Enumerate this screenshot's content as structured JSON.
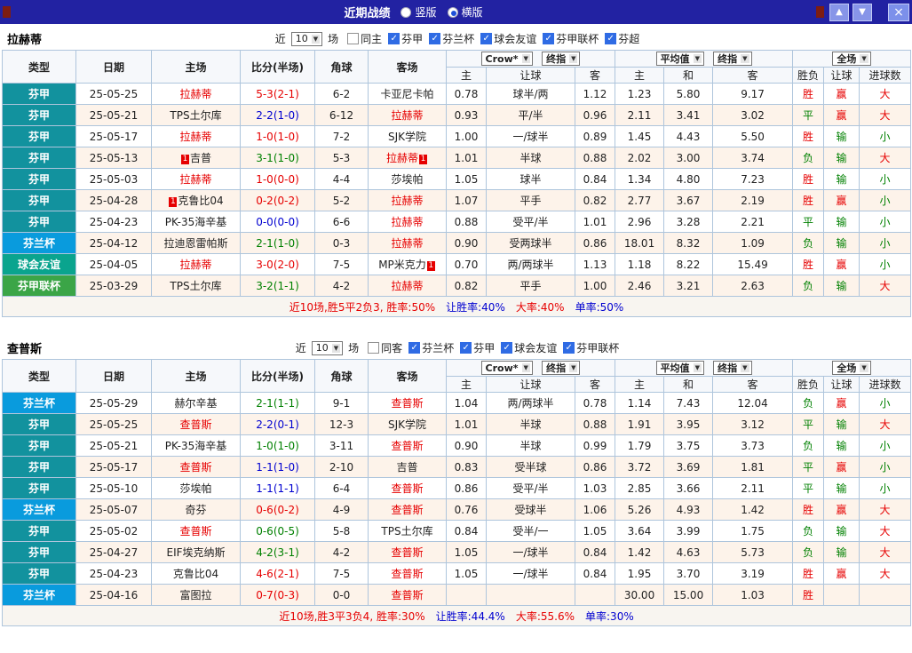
{
  "titlebar": {
    "title": "近期战绩",
    "radios": [
      {
        "label": "竖版",
        "checked": false
      },
      {
        "label": "横版",
        "checked": true
      }
    ]
  },
  "icons": {
    "up": "▲",
    "down": "▼",
    "close": "×",
    "dropdown": "▼",
    "check": "✓"
  },
  "colors": {
    "titlebar_bg": "#2222a2",
    "win_text": "#e60000",
    "loss_text": "#008000",
    "draw_text": "#0000d0",
    "checkbox_checked": "#2f6be4",
    "row_alt": "#fdf3ea"
  },
  "league_colors": {
    "芬甲": "#12929e",
    "芬兰杯": "#099bdd",
    "球会友谊": "#0aa48e",
    "芬甲联杯": "#3ba547"
  },
  "header": {
    "type": "类型",
    "date": "日期",
    "home": "主场",
    "score": "比分(半场)",
    "corners": "角球",
    "away": "客场",
    "odds_company": "Crow*",
    "stage": "终指",
    "average": "平均值",
    "stage2": "终指",
    "scope": "全场",
    "home_odds": "主",
    "handicap": "让球",
    "away_odds": "客",
    "avg_home": "主",
    "avg_draw": "和",
    "avg_away": "客",
    "win_loss": "胜负",
    "handicap_result": "让球",
    "goals": "进球数"
  },
  "sections": [
    {
      "team": "拉赫蒂",
      "filters": {
        "pre": "近",
        "count": "10",
        "post": "场",
        "items": [
          {
            "label": "同主",
            "checked": false
          },
          {
            "label": "芬甲",
            "checked": true
          },
          {
            "label": "芬兰杯",
            "checked": true
          },
          {
            "label": "球会友谊",
            "checked": true
          },
          {
            "label": "芬甲联杯",
            "checked": true
          },
          {
            "label": "芬超",
            "checked": true
          }
        ]
      },
      "rows": [
        {
          "type": "芬甲",
          "date": "25-05-25",
          "home": {
            "name": "拉赫蒂",
            "hl": true
          },
          "score": "5-3(2-1)",
          "res": "win",
          "corners": "6-2",
          "away": {
            "name": "卡亚尼卡帕",
            "hl": false
          },
          "odds": [
            "0.78",
            "球半/两",
            "1.12"
          ],
          "avg": [
            "1.23",
            "5.80",
            "9.17"
          ],
          "results": [
            "胜",
            "赢",
            "大"
          ]
        },
        {
          "type": "芬甲",
          "date": "25-05-21",
          "home": {
            "name": "TPS土尔库",
            "hl": false
          },
          "score": "2-2(1-0)",
          "res": "draw",
          "corners": "6-12",
          "away": {
            "name": "拉赫蒂",
            "hl": true
          },
          "odds": [
            "0.93",
            "平/半",
            "0.96"
          ],
          "avg": [
            "2.11",
            "3.41",
            "3.02"
          ],
          "results": [
            "平",
            "赢",
            "大"
          ]
        },
        {
          "type": "芬甲",
          "date": "25-05-17",
          "home": {
            "name": "拉赫蒂",
            "hl": true
          },
          "score": "1-0(1-0)",
          "res": "win",
          "corners": "7-2",
          "away": {
            "name": "SJK学院",
            "hl": false
          },
          "odds": [
            "1.00",
            "一/球半",
            "0.89"
          ],
          "avg": [
            "1.45",
            "4.43",
            "5.50"
          ],
          "results": [
            "胜",
            "输",
            "小"
          ]
        },
        {
          "type": "芬甲",
          "date": "25-05-13",
          "home": {
            "name": "吉普",
            "hl": false,
            "pre": "1"
          },
          "score": "3-1(1-0)",
          "res": "loss",
          "corners": "5-3",
          "away": {
            "name": "拉赫蒂",
            "hl": true,
            "post": "1"
          },
          "odds": [
            "1.01",
            "半球",
            "0.88"
          ],
          "avg": [
            "2.02",
            "3.00",
            "3.74"
          ],
          "results": [
            "负",
            "输",
            "大"
          ]
        },
        {
          "type": "芬甲",
          "date": "25-05-03",
          "home": {
            "name": "拉赫蒂",
            "hl": true
          },
          "score": "1-0(0-0)",
          "res": "win",
          "corners": "4-4",
          "away": {
            "name": "莎埃帕",
            "hl": false
          },
          "odds": [
            "1.05",
            "球半",
            "0.84"
          ],
          "avg": [
            "1.34",
            "4.80",
            "7.23"
          ],
          "results": [
            "胜",
            "输",
            "小"
          ]
        },
        {
          "type": "芬甲",
          "date": "25-04-28",
          "home": {
            "name": "克鲁比04",
            "hl": false,
            "pre": "1"
          },
          "score": "0-2(0-2)",
          "res": "win",
          "corners": "5-2",
          "away": {
            "name": "拉赫蒂",
            "hl": true
          },
          "odds": [
            "1.07",
            "平手",
            "0.82"
          ],
          "avg": [
            "2.77",
            "3.67",
            "2.19"
          ],
          "results": [
            "胜",
            "赢",
            "小"
          ]
        },
        {
          "type": "芬甲",
          "date": "25-04-23",
          "home": {
            "name": "PK-35海辛基",
            "hl": false
          },
          "score": "0-0(0-0)",
          "res": "draw",
          "corners": "6-6",
          "away": {
            "name": "拉赫蒂",
            "hl": true
          },
          "odds": [
            "0.88",
            "受平/半",
            "1.01"
          ],
          "avg": [
            "2.96",
            "3.28",
            "2.21"
          ],
          "results": [
            "平",
            "输",
            "小"
          ]
        },
        {
          "type": "芬兰杯",
          "date": "25-04-12",
          "home": {
            "name": "拉迪恩雷帕斯",
            "hl": false
          },
          "score": "2-1(1-0)",
          "res": "loss",
          "corners": "0-3",
          "away": {
            "name": "拉赫蒂",
            "hl": true
          },
          "odds": [
            "0.90",
            "受两球半",
            "0.86"
          ],
          "avg": [
            "18.01",
            "8.32",
            "1.09"
          ],
          "results": [
            "负",
            "输",
            "小"
          ]
        },
        {
          "type": "球会友谊",
          "date": "25-04-05",
          "home": {
            "name": "拉赫蒂",
            "hl": true
          },
          "score": "3-0(2-0)",
          "res": "win",
          "corners": "7-5",
          "away": {
            "name": "MP米克力",
            "hl": false,
            "post": "1"
          },
          "odds": [
            "0.70",
            "两/两球半",
            "1.13"
          ],
          "avg": [
            "1.18",
            "8.22",
            "15.49"
          ],
          "results": [
            "胜",
            "赢",
            "小"
          ]
        },
        {
          "type": "芬甲联杯",
          "date": "25-03-29",
          "home": {
            "name": "TPS土尔库",
            "hl": false
          },
          "score": "3-2(1-1)",
          "res": "loss",
          "corners": "4-2",
          "away": {
            "name": "拉赫蒂",
            "hl": true
          },
          "odds": [
            "0.82",
            "平手",
            "1.00"
          ],
          "avg": [
            "2.46",
            "3.21",
            "2.63"
          ],
          "results": [
            "负",
            "输",
            "大"
          ]
        }
      ],
      "summary": [
        {
          "text": "近10场,胜5平2负3, 胜率:50%",
          "cls": "red"
        },
        {
          "text": "让胜率:40%",
          "cls": "blue"
        },
        {
          "text": "大率:40%",
          "cls": "red"
        },
        {
          "text": "单率:50%",
          "cls": "blue"
        }
      ]
    },
    {
      "team": "查普斯",
      "filters": {
        "pre": "近",
        "count": "10",
        "post": "场",
        "items": [
          {
            "label": "同客",
            "checked": false
          },
          {
            "label": "芬兰杯",
            "checked": true
          },
          {
            "label": "芬甲",
            "checked": true
          },
          {
            "label": "球会友谊",
            "checked": true
          },
          {
            "label": "芬甲联杯",
            "checked": true
          }
        ]
      },
      "rows": [
        {
          "type": "芬兰杯",
          "date": "25-05-29",
          "home": {
            "name": "赫尔辛基",
            "hl": false
          },
          "score": "2-1(1-1)",
          "res": "loss",
          "corners": "9-1",
          "away": {
            "name": "查普斯",
            "hl": true
          },
          "odds": [
            "1.04",
            "两/两球半",
            "0.78"
          ],
          "avg": [
            "1.14",
            "7.43",
            "12.04"
          ],
          "results": [
            "负",
            "赢",
            "小"
          ]
        },
        {
          "type": "芬甲",
          "date": "25-05-25",
          "home": {
            "name": "查普斯",
            "hl": true
          },
          "score": "2-2(0-1)",
          "res": "draw",
          "corners": "12-3",
          "away": {
            "name": "SJK学院",
            "hl": false
          },
          "odds": [
            "1.01",
            "半球",
            "0.88"
          ],
          "avg": [
            "1.91",
            "3.95",
            "3.12"
          ],
          "results": [
            "平",
            "输",
            "大"
          ]
        },
        {
          "type": "芬甲",
          "date": "25-05-21",
          "home": {
            "name": "PK-35海辛基",
            "hl": false
          },
          "score": "1-0(1-0)",
          "res": "loss",
          "corners": "3-11",
          "away": {
            "name": "查普斯",
            "hl": true
          },
          "odds": [
            "0.90",
            "半球",
            "0.99"
          ],
          "avg": [
            "1.79",
            "3.75",
            "3.73"
          ],
          "results": [
            "负",
            "输",
            "小"
          ]
        },
        {
          "type": "芬甲",
          "date": "25-05-17",
          "home": {
            "name": "查普斯",
            "hl": true
          },
          "score": "1-1(1-0)",
          "res": "draw",
          "corners": "2-10",
          "away": {
            "name": "吉普",
            "hl": false
          },
          "odds": [
            "0.83",
            "受半球",
            "0.86"
          ],
          "avg": [
            "3.72",
            "3.69",
            "1.81"
          ],
          "results": [
            "平",
            "赢",
            "小"
          ]
        },
        {
          "type": "芬甲",
          "date": "25-05-10",
          "home": {
            "name": "莎埃帕",
            "hl": false
          },
          "score": "1-1(1-1)",
          "res": "draw",
          "corners": "6-4",
          "away": {
            "name": "查普斯",
            "hl": true
          },
          "odds": [
            "0.86",
            "受平/半",
            "1.03"
          ],
          "avg": [
            "2.85",
            "3.66",
            "2.11"
          ],
          "results": [
            "平",
            "输",
            "小"
          ]
        },
        {
          "type": "芬兰杯",
          "date": "25-05-07",
          "home": {
            "name": "奇芬",
            "hl": false
          },
          "score": "0-6(0-2)",
          "res": "win",
          "corners": "4-9",
          "away": {
            "name": "查普斯",
            "hl": true
          },
          "odds": [
            "0.76",
            "受球半",
            "1.06"
          ],
          "avg": [
            "5.26",
            "4.93",
            "1.42"
          ],
          "results": [
            "胜",
            "赢",
            "大"
          ]
        },
        {
          "type": "芬甲",
          "date": "25-05-02",
          "home": {
            "name": "查普斯",
            "hl": true
          },
          "score": "0-6(0-5)",
          "res": "loss",
          "corners": "5-8",
          "away": {
            "name": "TPS土尔库",
            "hl": false
          },
          "odds": [
            "0.84",
            "受半/一",
            "1.05"
          ],
          "avg": [
            "3.64",
            "3.99",
            "1.75"
          ],
          "results": [
            "负",
            "输",
            "大"
          ]
        },
        {
          "type": "芬甲",
          "date": "25-04-27",
          "home": {
            "name": "EIF埃克纳斯",
            "hl": false
          },
          "score": "4-2(3-1)",
          "res": "loss",
          "corners": "4-2",
          "away": {
            "name": "查普斯",
            "hl": true
          },
          "odds": [
            "1.05",
            "一/球半",
            "0.84"
          ],
          "avg": [
            "1.42",
            "4.63",
            "5.73"
          ],
          "results": [
            "负",
            "输",
            "大"
          ]
        },
        {
          "type": "芬甲",
          "date": "25-04-23",
          "home": {
            "name": "克鲁比04",
            "hl": false
          },
          "score": "4-6(2-1)",
          "res": "win",
          "corners": "7-5",
          "away": {
            "name": "查普斯",
            "hl": true
          },
          "odds": [
            "1.05",
            "一/球半",
            "0.84"
          ],
          "avg": [
            "1.95",
            "3.70",
            "3.19"
          ],
          "results": [
            "胜",
            "赢",
            "大"
          ]
        },
        {
          "type": "芬兰杯",
          "date": "25-04-16",
          "home": {
            "name": "富图拉",
            "hl": false
          },
          "score": "0-7(0-3)",
          "res": "win",
          "corners": "0-0",
          "away": {
            "name": "查普斯",
            "hl": true
          },
          "odds": [
            "",
            "",
            ""
          ],
          "avg": [
            "30.00",
            "15.00",
            "1.03"
          ],
          "results": [
            "胜",
            "",
            ""
          ]
        }
      ],
      "summary": [
        {
          "text": "近10场,胜3平3负4, 胜率:30%",
          "cls": "red"
        },
        {
          "text": "让胜率:44.4%",
          "cls": "blue"
        },
        {
          "text": "大率:55.6%",
          "cls": "red"
        },
        {
          "text": "单率:30%",
          "cls": "blue"
        }
      ]
    }
  ]
}
